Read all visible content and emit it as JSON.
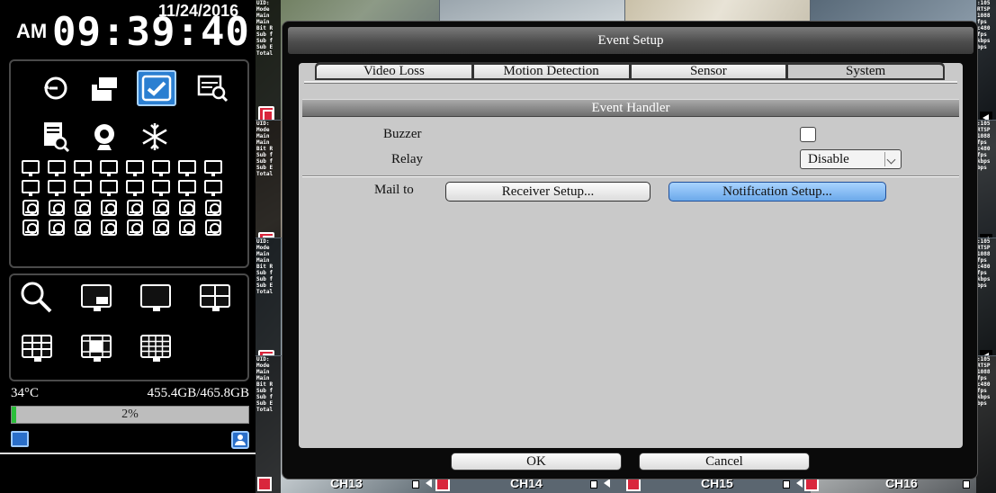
{
  "clock": {
    "date": "11/24/2016",
    "ampm": "AM",
    "time": "09:39:40"
  },
  "status": {
    "temperature": "34°C",
    "disk": "455.4GB/465.8GB",
    "usage_percent_text": "2%",
    "usage_fraction": 0.02
  },
  "dialog": {
    "title": "Event Setup",
    "tabs": [
      "Video Loss",
      "Motion Detection",
      "Sensor",
      "System"
    ],
    "active_tab": 3,
    "section_title": "Event Handler",
    "buzzer_label": "Buzzer",
    "buzzer_checked": false,
    "relay_label": "Relay",
    "relay_value": "Disable",
    "mail_label": "Mail to",
    "receiver_button": "Receiver Setup...",
    "notification_button": "Notification Setup...",
    "ok_button": "OK",
    "cancel_button": "Cancel"
  },
  "channels": [
    "CH13",
    "CH14",
    "CH15",
    "CH16"
  ],
  "overlay_info": {
    "left": [
      "UID:",
      "Mode",
      "Main",
      "Main",
      "Bit R",
      "Sub f",
      "Sub f",
      "Sub E",
      "Total"
    ],
    "right": [
      ":105",
      "RTSP",
      "1088",
      "fps",
      "c480",
      "fps",
      "kbps",
      "bps"
    ]
  },
  "colors": {
    "accent": "#2b7fd1",
    "record": "#d9263c",
    "progress": "#2bbf3a"
  }
}
